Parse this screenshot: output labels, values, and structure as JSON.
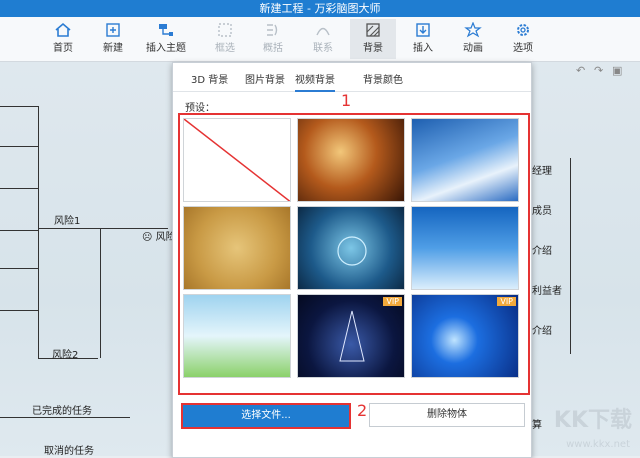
{
  "window": {
    "title": "新建工程 - 万彩脑图大师"
  },
  "toolbar": [
    {
      "label": "首页",
      "icon": "home-icon",
      "enabled": true
    },
    {
      "label": "新建",
      "icon": "new-file-icon",
      "enabled": true
    },
    {
      "label": "插入主题",
      "icon": "insert-topic-icon",
      "enabled": true
    },
    {
      "label": "框选",
      "icon": "box-select-icon",
      "enabled": false
    },
    {
      "label": "概括",
      "icon": "summary-icon",
      "enabled": false
    },
    {
      "label": "联系",
      "icon": "relation-icon",
      "enabled": false
    },
    {
      "label": "背景",
      "icon": "background-icon",
      "enabled": true
    },
    {
      "label": "插入",
      "icon": "insert-icon",
      "enabled": true
    },
    {
      "label": "动画",
      "icon": "animation-icon",
      "enabled": true
    },
    {
      "label": "选项",
      "icon": "gear-icon",
      "enabled": true
    }
  ],
  "mindmap": {
    "left_nodes": [
      "风险1",
      "风险2",
      "已完成的任务",
      "取消的任务"
    ],
    "center_node": "风险",
    "right_nodes": [
      "经理",
      "成员",
      "介绍",
      "利益者",
      "介绍",
      "算"
    ]
  },
  "panel": {
    "tabs": [
      "3D 背景",
      "图片背景",
      "视频背景",
      "背景颜色"
    ],
    "active_tab": 2,
    "preset_label": "预设：",
    "marker_1": "1",
    "marker_2": "2",
    "thumbnails": [
      {
        "name": "none",
        "vip": false
      },
      {
        "name": "autumn-leaves",
        "vip": false
      },
      {
        "name": "blue-sky",
        "vip": false
      },
      {
        "name": "golden-bubbles",
        "vip": false
      },
      {
        "name": "water-drop",
        "vip": false
      },
      {
        "name": "snowflakes",
        "vip": false
      },
      {
        "name": "spring-bokeh",
        "vip": false
      },
      {
        "name": "christmas-tree",
        "vip": true
      },
      {
        "name": "blue-light",
        "vip": true
      }
    ],
    "vip_badge": "VIP",
    "choose_file_button": "选择文件...",
    "delete_button": "删除物体"
  },
  "watermark": {
    "main": "KK下载",
    "url": "www.kkx.net"
  }
}
